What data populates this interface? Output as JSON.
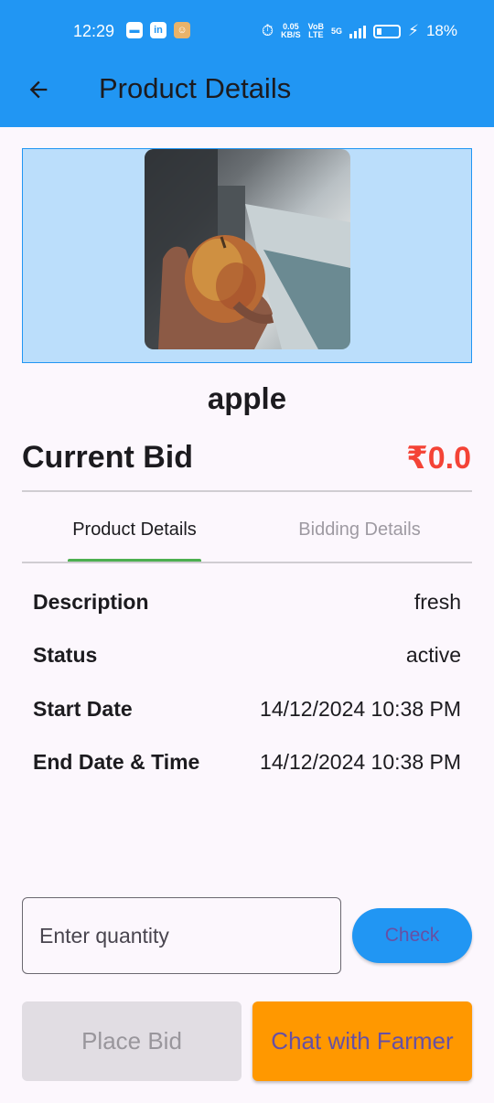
{
  "status_bar": {
    "time": "12:29",
    "net_speed": "0.05",
    "net_unit": "KB/S",
    "network_label_top": "VoB",
    "network_label_bottom": "LTE",
    "signal_5g": "5G",
    "battery": "18%"
  },
  "app_bar": {
    "title": "Product Details",
    "back_icon": "arrow-left-icon",
    "color": "#2196f3"
  },
  "product": {
    "name": "apple",
    "current_bid_label": "Current Bid",
    "current_bid_value": "₹0.0"
  },
  "tabs": [
    {
      "label": "Product Details",
      "active": true
    },
    {
      "label": "Bidding Details",
      "active": false
    }
  ],
  "details": [
    {
      "label": "Description",
      "value": "fresh"
    },
    {
      "label": "Status",
      "value": "active"
    },
    {
      "label": "Start Date",
      "value": "14/12/2024 10:38 PM"
    },
    {
      "label": "End Date & Time",
      "value": "14/12/2024 10:38 PM"
    }
  ],
  "quantity": {
    "placeholder": "Enter quantity",
    "value": "",
    "check_label": "Check"
  },
  "actions": {
    "place_bid_label": "Place Bid",
    "chat_label": "Chat with Farmer"
  },
  "colors": {
    "accent": "#2196f3",
    "bid_value": "#f44336",
    "tab_indicator": "#4caf50",
    "chat_button": "#ff9800"
  }
}
